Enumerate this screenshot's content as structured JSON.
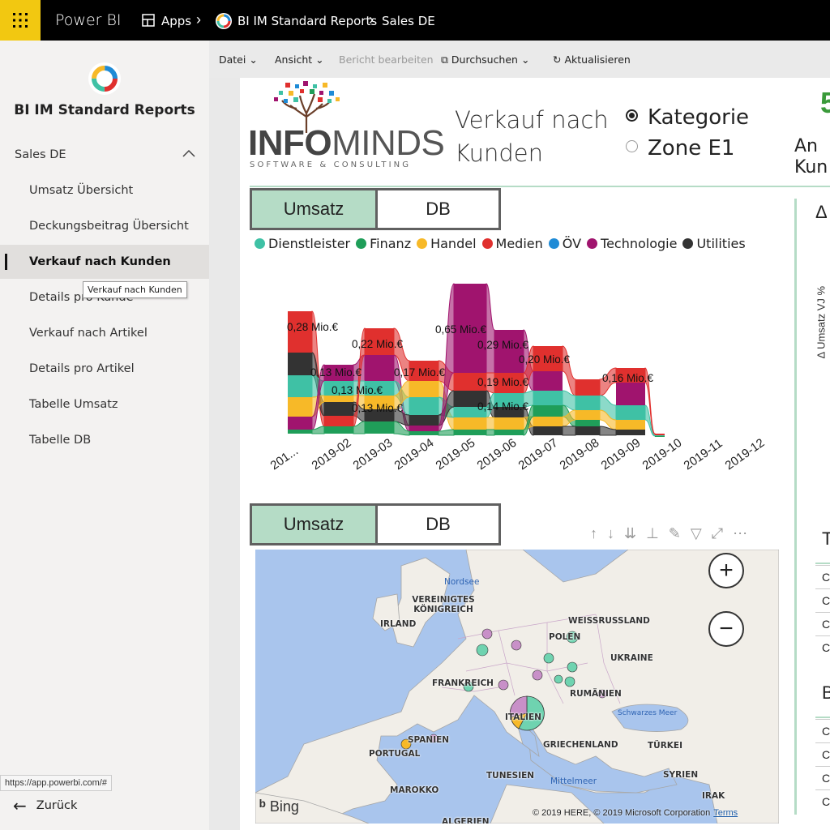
{
  "topbar": {
    "brand": "Power BI",
    "apps": "Apps",
    "workspace": "BI IM Standard Reports",
    "page": "Sales DE"
  },
  "sidebar": {
    "title": "BI IM Standard Reports",
    "section": "Sales DE",
    "items": [
      {
        "label": "Umsatz Übersicht"
      },
      {
        "label": "Deckungsbeitrag Übersicht"
      },
      {
        "label": "Verkauf nach Kunden"
      },
      {
        "label": "Details pro Kunde"
      },
      {
        "label": "Verkauf nach Artikel"
      },
      {
        "label": "Details pro Artikel"
      },
      {
        "label": "Tabelle Umsatz"
      },
      {
        "label": "Tabelle DB"
      }
    ],
    "active_index": 2,
    "tooltip": "Verkauf nach Kunden",
    "back": "Zurück"
  },
  "statusbar": {
    "url": "https://app.powerbi.com/#"
  },
  "toolbar": {
    "file": "Datei",
    "view": "Ansicht",
    "edit": "Bericht bearbeiten",
    "explore": "Durchsuchen",
    "refresh": "Aktualisieren"
  },
  "report": {
    "logo_word_bold": "INFO",
    "logo_word_thin": "MINDS",
    "logo_sub": "SOFTWARE & CONSULTING",
    "title": "Verkauf nach Kunden",
    "radio": {
      "options": [
        "Kategorie",
        "Zone E1"
      ],
      "selected": "Kategorie"
    },
    "kpi_value": "5",
    "kpi_label_1": "An",
    "kpi_label_2": "Kun",
    "toggle1": {
      "on": "Umsatz",
      "off": "DB"
    },
    "toggle2": {
      "on": "Umsatz",
      "off": "DB"
    },
    "side_delta": "Δ",
    "side_axis_label": "Δ Umsatz VJ %",
    "side_table_head_1": "T",
    "side_table_head_2": "B",
    "side_table_cell": "C"
  },
  "chart_data": {
    "type": "area",
    "chart_subtype": "ribbon",
    "categories": [
      "201...",
      "2019-02",
      "2019-03",
      "2019-04",
      "2019-05",
      "2019-06",
      "2019-07",
      "2019-08",
      "2019-09",
      "2019-10",
      "2019-11",
      "2019-12"
    ],
    "series": [
      {
        "name": "Dienstleister",
        "color": "#3fc1a5"
      },
      {
        "name": "Finanz",
        "color": "#1f9e59"
      },
      {
        "name": "Handel",
        "color": "#f7b928"
      },
      {
        "name": "Medien",
        "color": "#e0302e"
      },
      {
        "name": "ÖV",
        "color": "#1f8bd6"
      },
      {
        "name": "Technologie",
        "color": "#a0146e"
      },
      {
        "name": "Utilities",
        "color": "#333333"
      }
    ],
    "data_labels": [
      {
        "text": "0,28 Mio.€"
      },
      {
        "text": "0,13 Mio.€"
      },
      {
        "text": "0,22 Mio.€"
      },
      {
        "text": "0,13 Mio.€"
      },
      {
        "text": "0,13 Mio.€"
      },
      {
        "text": "0,17 Mio.€"
      },
      {
        "text": "0,65 Mio.€"
      },
      {
        "text": "0,29 Mio.€"
      },
      {
        "text": "0,19 Mio.€"
      },
      {
        "text": "0,14 Mio.€"
      },
      {
        "text": "0,20 Mio.€"
      },
      {
        "text": "0,16 Mio.€"
      }
    ]
  },
  "map": {
    "countries": [
      "VEREINIGTES KÖNIGREICH",
      "IRLAND",
      "WEISSRUSSLAND",
      "POLEN",
      "UKRAINE",
      "FRANKREICH",
      "RUMÄNIEN",
      "ITALIEN",
      "SPANIEN",
      "PORTUGAL",
      "GRIECHENLAND",
      "TÜRKEI",
      "MAROKKO",
      "TUNESIEN",
      "SYRIEN",
      "IRAK",
      "ALGERIEN"
    ],
    "seas": [
      "Nordsee",
      "Schwarzes Meer",
      "Mittelmeer"
    ],
    "bing": "Bing",
    "copyright": "© 2019 HERE, © 2019 Microsoft Corporation",
    "terms": "Terms",
    "zoom_in": "+",
    "zoom_out": "−"
  }
}
